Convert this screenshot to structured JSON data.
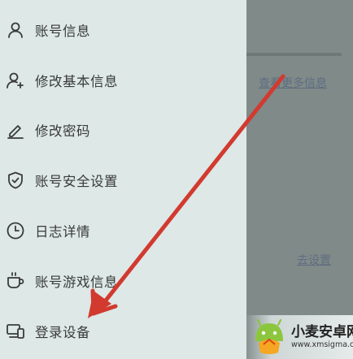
{
  "drawer": {
    "items": [
      {
        "label": "账号信息",
        "icon": "user-icon"
      },
      {
        "label": "修改基本信息",
        "icon": "user-add-icon"
      },
      {
        "label": "修改密码",
        "icon": "pencil-icon"
      },
      {
        "label": "账号安全设置",
        "icon": "shield-check-icon"
      },
      {
        "label": "日志详情",
        "icon": "clock-icon"
      },
      {
        "label": "账号游戏信息",
        "icon": "cup-icon"
      },
      {
        "label": "登录设备",
        "icon": "devices-icon"
      }
    ]
  },
  "background": {
    "more_info_link": "查看更多信息",
    "settings_link": "去设置"
  },
  "watermark": {
    "name": "小麦安卓网",
    "url": "www.xmsigma.com"
  },
  "colors": {
    "drawer_bg": "#dde8e7",
    "overlay": "#7f8a89",
    "arrow": "#d23a2f",
    "text": "#3a3a3a"
  }
}
